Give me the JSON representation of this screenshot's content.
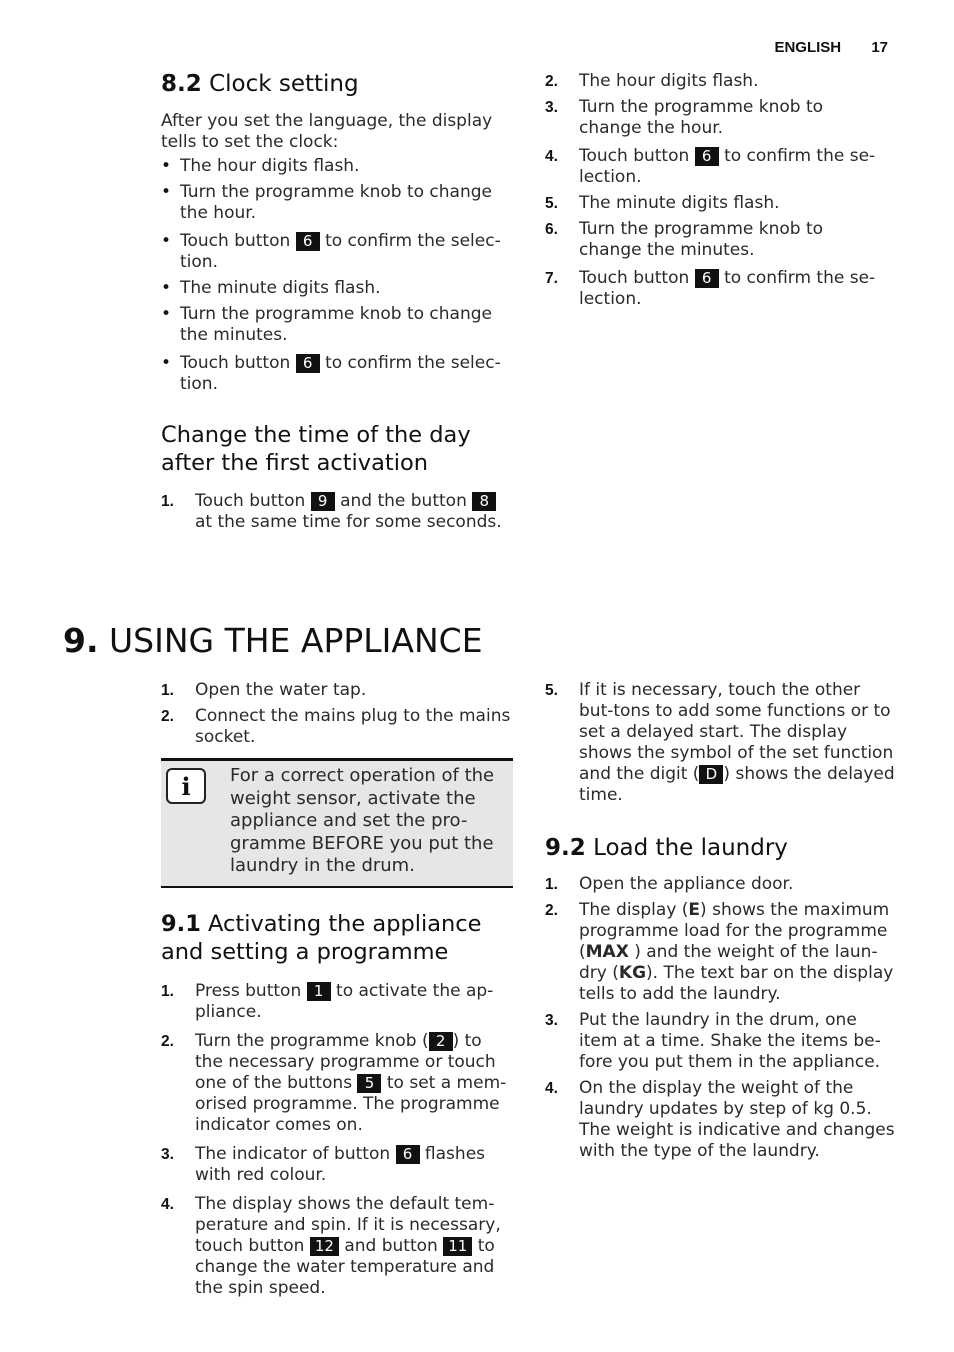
{
  "header": {
    "language": "ENGLISH",
    "page_number": "17"
  },
  "clock_setting": {
    "num": "8.2",
    "title": "Clock setting",
    "intro": "After you set the language, the display tells to set the clock:",
    "bullets": [
      {
        "text": "The hour digits flash."
      },
      {
        "text": "Turn the programme knob to change the hour."
      },
      {
        "pre": "Touch button ",
        "key": "6",
        "post": " to confirm the selec-tion."
      },
      {
        "text": "The minute digits flash."
      },
      {
        "text": "Turn the programme knob to change the minutes."
      },
      {
        "pre": "Touch button ",
        "key": "6",
        "post": " to confirm the selec-tion."
      }
    ],
    "steps_continued": [
      {
        "num": "2.",
        "text": "The hour digits flash."
      },
      {
        "num": "3.",
        "text": "Turn the programme knob to change the hour."
      },
      {
        "num": "4.",
        "pre": "Touch button ",
        "key": "6",
        "post": " to confirm the se-lection."
      },
      {
        "num": "5.",
        "text": "The minute digits flash."
      },
      {
        "num": "6.",
        "text": "Turn the programme knob to change the minutes."
      },
      {
        "num": "7.",
        "pre": "Touch button ",
        "key": "6",
        "post": " to confirm the se-lection."
      }
    ]
  },
  "change_time": {
    "title": "Change the time of the day after the first activation",
    "steps": [
      {
        "num": "1.",
        "pre": "Touch button ",
        "key1": "9",
        "mid": " and the button ",
        "key2": "8",
        "post": " at the same time for some seconds."
      }
    ]
  },
  "using": {
    "num": "9.",
    "title": "USING THE APPLIANCE",
    "steps": [
      {
        "num": "1.",
        "text": "Open the water tap."
      },
      {
        "num": "2.",
        "text": "Connect the mains plug to the mains socket."
      }
    ],
    "info_icon": "info-icon",
    "info_text": "For a correct operation of the weight sensor, activate the appliance and set the pro-gramme BEFORE you put the laundry in the drum.",
    "step5": {
      "num": "5.",
      "pre": "If it is necessary, touch the other but-tons to add some functions or to set a delayed start. The display shows the symbol of the set function and the digit (",
      "key": "D",
      "post": ") shows the delayed time."
    }
  },
  "activating": {
    "num": "9.1",
    "title": "Activating the appliance and setting a programme",
    "steps": [
      {
        "num": "1.",
        "pre": "Press button ",
        "key": "1",
        "post": " to activate the ap-pliance."
      },
      {
        "num": "2.",
        "pre": "Turn the programme knob (",
        "key": "2",
        "mid": ") to the necessary programme or touch one of the buttons ",
        "key2": "5",
        "post": " to set a mem-orised programme. The programme indicator comes on."
      },
      {
        "num": "3.",
        "pre": "The indicator of button ",
        "key": "6",
        "post": " flashes with red colour."
      },
      {
        "num": "4.",
        "pre": "The display shows the default tem-perature and spin. If it is necessary, touch button ",
        "key": "12",
        "mid": " and button ",
        "key2": "11",
        "post": " to change the water temperature and the spin speed."
      }
    ]
  },
  "load_laundry": {
    "num": "9.2",
    "title": "Load the laundry",
    "steps": [
      {
        "num": "1.",
        "text": "Open the appliance door."
      },
      {
        "num": "2.",
        "a": "The display (",
        "b1": "E",
        "c": ") shows the maximum programme load for the programme (",
        "b2": "MAX",
        "d": " ) and the weight of the laun-dry (",
        "b3": "KG",
        "e": "). The text bar on the display tells to add the laundry."
      },
      {
        "num": "3.",
        "text": "Put the laundry in the drum, one item at a time. Shake the items be-fore you put them in the appliance."
      },
      {
        "num": "4.",
        "text": "On the display the weight of the laundry updates by step of kg 0.5. The weight is indicative and changes with the type of the laundry."
      }
    ]
  }
}
